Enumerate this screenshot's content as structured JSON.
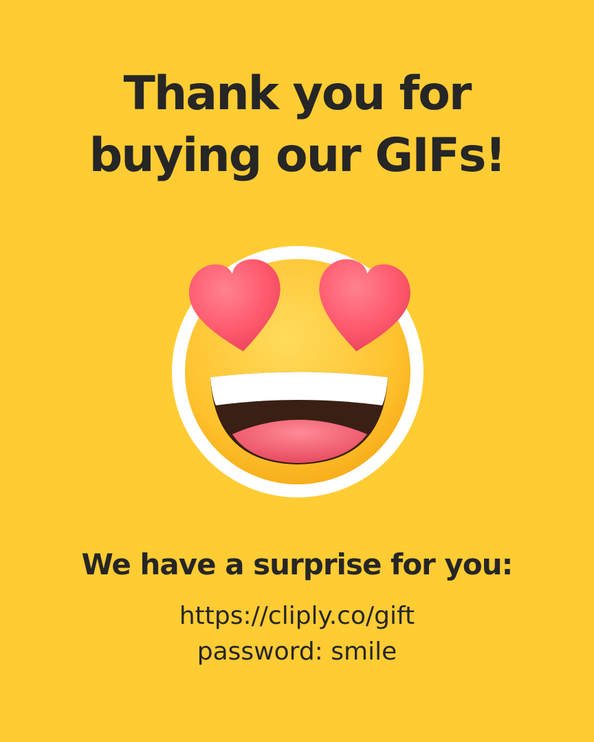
{
  "headline": {
    "line1": "Thank you for",
    "line2": "buying our GIFs!"
  },
  "emoji": {
    "icon": "heart-eyes-face-icon",
    "colors": {
      "face": "#FFC933",
      "outline": "#FFFFFF",
      "heart": "#FF5A6E",
      "mouth": "#3A1F14",
      "tongue": "#F2566A",
      "teeth": "#FFFFFF"
    }
  },
  "surprise": {
    "heading": "We have a surprise for you:",
    "link": "https://cliply.co/gift",
    "password": "password: smile"
  },
  "colors": {
    "background": "#FFCC33",
    "text": "#262626"
  }
}
